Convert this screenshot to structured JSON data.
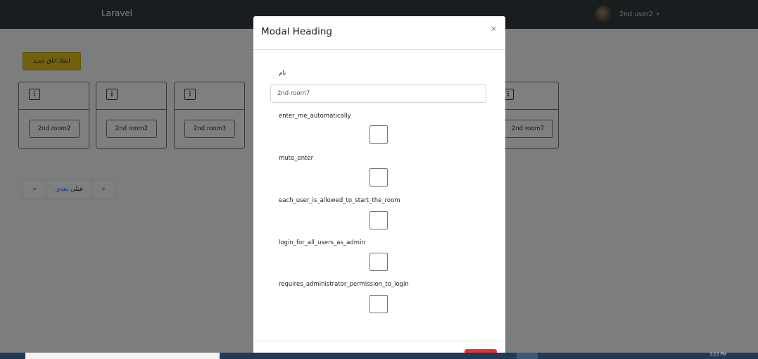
{
  "navbar": {
    "brand": "Laravel",
    "user_name": "2nd user2",
    "caret": "▾"
  },
  "page": {
    "create_button": "ایجاد اتاق جدید",
    "rooms": [
      {
        "name": "2nd room2"
      },
      {
        "name": "2nd room2"
      },
      {
        "name": "2nd room3"
      },
      {
        "name": "2nd room7"
      }
    ],
    "kebab_glyph": "⋮",
    "pagination": {
      "first": "«",
      "previous": "قبلی",
      "next": "بعدی",
      "last": "»"
    }
  },
  "modal": {
    "title": "Modal Heading",
    "close": "×",
    "name_label": "نام",
    "name_value": "2nd room7",
    "checkboxes": [
      {
        "label": "enter_me_automatically"
      },
      {
        "label": "mute_enter"
      },
      {
        "label": "each_user_is_allowed_to_start_the_room"
      },
      {
        "label": "login_for_all_users_as_admin"
      },
      {
        "label": "requires_administrator_permission_to_login"
      }
    ]
  },
  "taskbar": {
    "clock": "3:13 PM"
  },
  "colors": {
    "navbar": "#343a40",
    "create_button": "#e3c11a",
    "link": "#007bff",
    "danger": "#e3342f"
  }
}
